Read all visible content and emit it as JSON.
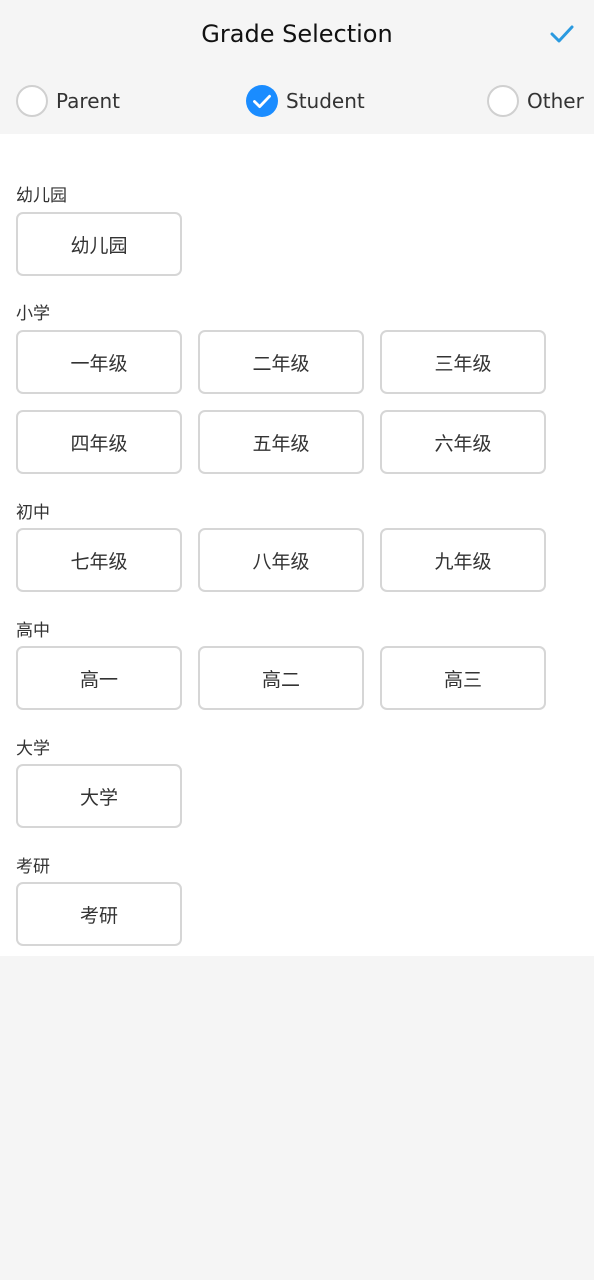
{
  "header": {
    "title": "Grade Selection",
    "confirm_icon": "checkmark-icon",
    "accent_color": "#2a9ae0"
  },
  "roles": [
    {
      "label": "Parent",
      "checked": false
    },
    {
      "label": "Student",
      "checked": true
    },
    {
      "label": "Other",
      "checked": false
    }
  ],
  "colors": {
    "radio_checked": "#1a8cff",
    "button_border": "#d6d6d6"
  },
  "sections": [
    {
      "title": "幼儿园",
      "grades": [
        "幼儿园"
      ]
    },
    {
      "title": "小学",
      "grades": [
        "一年级",
        "二年级",
        "三年级",
        "四年级",
        "五年级",
        "六年级"
      ]
    },
    {
      "title": "初中",
      "grades": [
        "七年级",
        "八年级",
        "九年级"
      ]
    },
    {
      "title": "高中",
      "grades": [
        "高一",
        "高二",
        "高三"
      ]
    },
    {
      "title": "大学",
      "grades": [
        "大学"
      ]
    },
    {
      "title": "考研",
      "grades": [
        "考研"
      ]
    }
  ]
}
